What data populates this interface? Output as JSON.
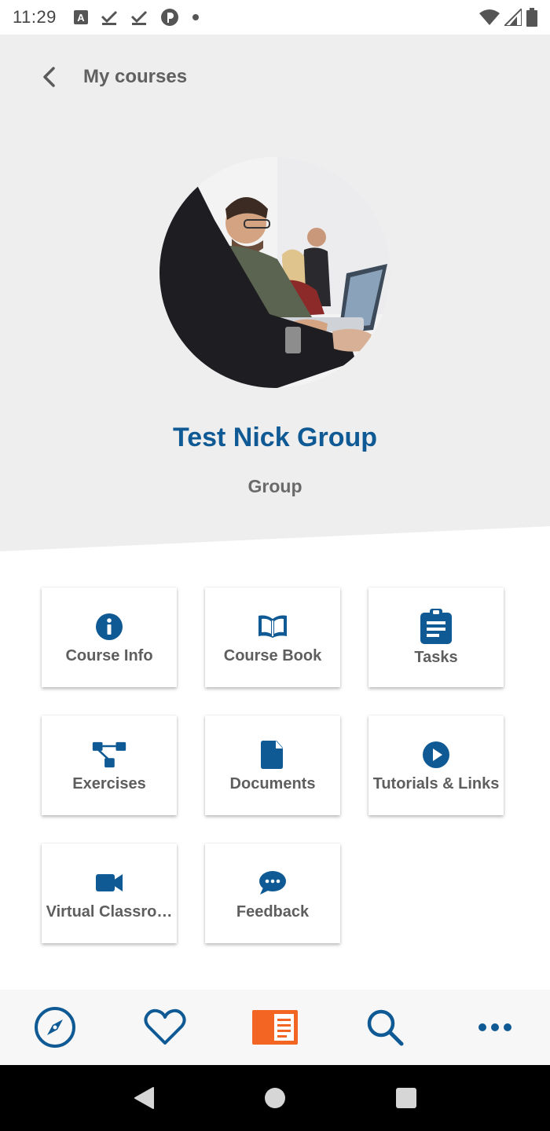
{
  "status_bar": {
    "time": "11:29",
    "icons_left": [
      "text-a-icon",
      "download-check-icon",
      "download-check-icon",
      "pocket-icon",
      "dot-icon"
    ],
    "icons_right": [
      "wifi-icon",
      "signal-icon",
      "battery-icon"
    ]
  },
  "header": {
    "back_label": "My courses"
  },
  "group": {
    "title": "Test Nick Group",
    "subtitle": "Group"
  },
  "tiles": [
    {
      "label": "Course Info",
      "icon": "info-icon"
    },
    {
      "label": "Course Book",
      "icon": "book-icon"
    },
    {
      "label": "Tasks",
      "icon": "clipboard-icon"
    },
    {
      "label": "Exercises",
      "icon": "hierarchy-icon"
    },
    {
      "label": "Documents",
      "icon": "document-icon"
    },
    {
      "label": "Tutorials & Links",
      "icon": "play-circle-icon"
    },
    {
      "label": "Virtual Classro…",
      "icon": "video-camera-icon"
    },
    {
      "label": "Feedback",
      "icon": "chat-bubble-icon"
    }
  ],
  "bottom_nav": [
    "compass-icon",
    "heart-icon",
    "courses-icon",
    "search-icon",
    "more-icon"
  ],
  "colors": {
    "primary": "#0f5a94",
    "accent": "#f26522",
    "header_bg": "#eeeeee",
    "label_gray": "#5e5e5e"
  }
}
